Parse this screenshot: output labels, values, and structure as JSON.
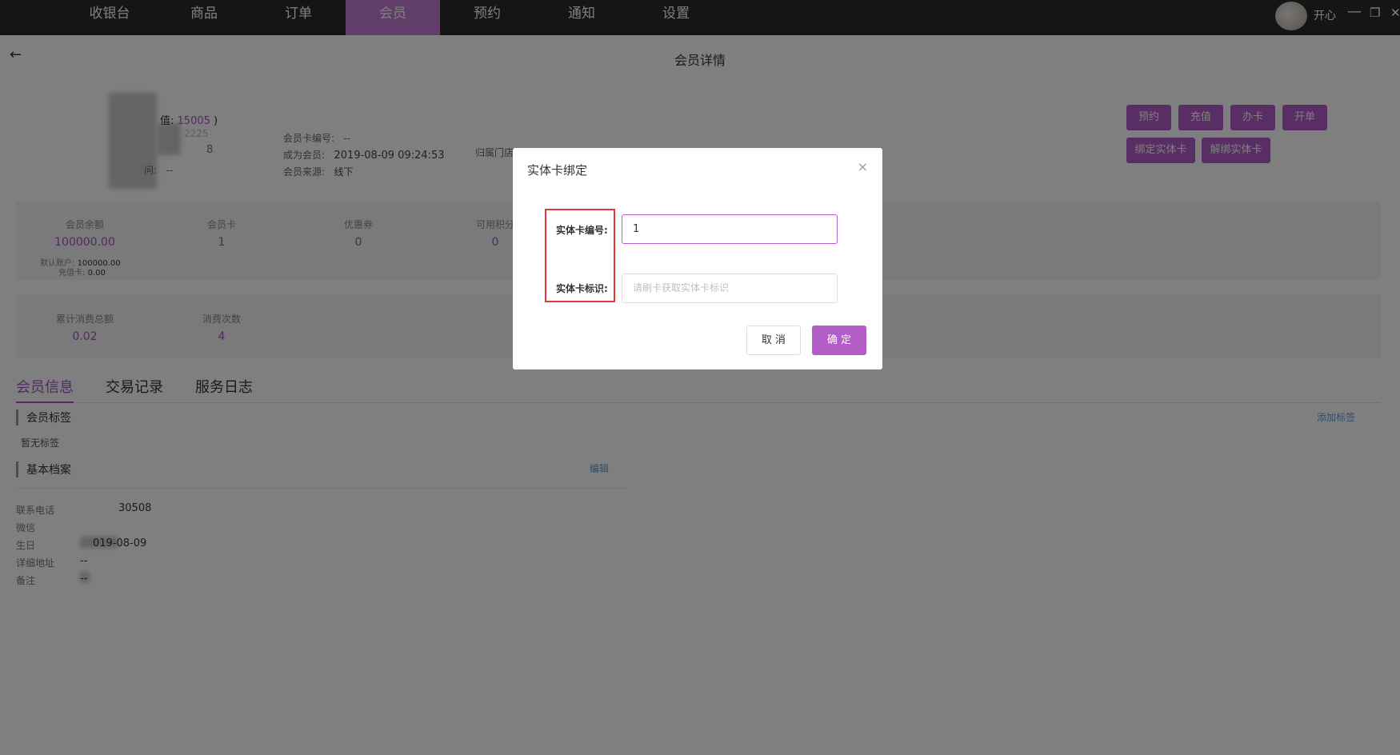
{
  "nav": {
    "items": [
      "收银台",
      "商品",
      "订单",
      "会员",
      "预约",
      "通知",
      "设置"
    ],
    "active_index": 3
  },
  "user": {
    "name": "开心"
  },
  "window": {
    "minimize": "—",
    "restore": "❐",
    "close": "✕"
  },
  "page": {
    "back": "←",
    "title": "会员详情"
  },
  "profile": {
    "points_prefix": "值:",
    "points_value": "15005",
    "points_suffix": ")",
    "partial_1": "2225",
    "partial_2": "8",
    "partial_3": "问:",
    "partial_3_val": "--",
    "card_no_label": "会员卡编号:",
    "card_no_value": "--",
    "join_label": "成为会员:",
    "join_value": "2019-08-09 09:24:53",
    "source_label": "会员来源:",
    "source_value": "线下",
    "store_label": "归属门店:"
  },
  "actions": {
    "row1": [
      "预约",
      "充值",
      "办卡",
      "开单"
    ],
    "row2": [
      "绑定实体卡",
      "解绑实体卡"
    ]
  },
  "stats_row1": [
    {
      "label": "会员余额",
      "value": "100000.00"
    },
    {
      "label": "会员卡",
      "value": "1"
    },
    {
      "label": "优惠券",
      "value": "0"
    },
    {
      "label": "可用积分",
      "value": "0"
    }
  ],
  "balance_detail": {
    "default_label": "默认账户:",
    "default_value": "100000.00",
    "card_label": "充值卡:",
    "card_value": "0.00"
  },
  "stats_row2": [
    {
      "label": "累计消费总额",
      "value": "0.02"
    },
    {
      "label": "消费次数",
      "value": "4"
    }
  ],
  "tabs": [
    "会员信息",
    "交易记录",
    "服务日志"
  ],
  "tags": {
    "title": "会员标签",
    "empty": "暂无标签",
    "add": "添加标签"
  },
  "archive": {
    "title": "基本档案",
    "edit": "编辑",
    "rows": [
      {
        "label": "联系电话",
        "value": "30508"
      },
      {
        "label": "微信",
        "value": ""
      },
      {
        "label": "生日",
        "value": "019-08-09"
      },
      {
        "label": "详细地址",
        "value": "--"
      },
      {
        "label": "备注",
        "value": "--"
      }
    ]
  },
  "modal": {
    "title": "实体卡绑定",
    "close": "×",
    "card_no_label": "实体卡编号:",
    "card_no_value": "1",
    "card_id_label": "实体卡标识:",
    "card_id_placeholder": "请刷卡获取实体卡标识",
    "cancel": "取 消",
    "ok": "确 定"
  },
  "colors": {
    "accent": "#b35dc9",
    "topbar": "#2b2b2b",
    "highlight": "#e53935"
  }
}
